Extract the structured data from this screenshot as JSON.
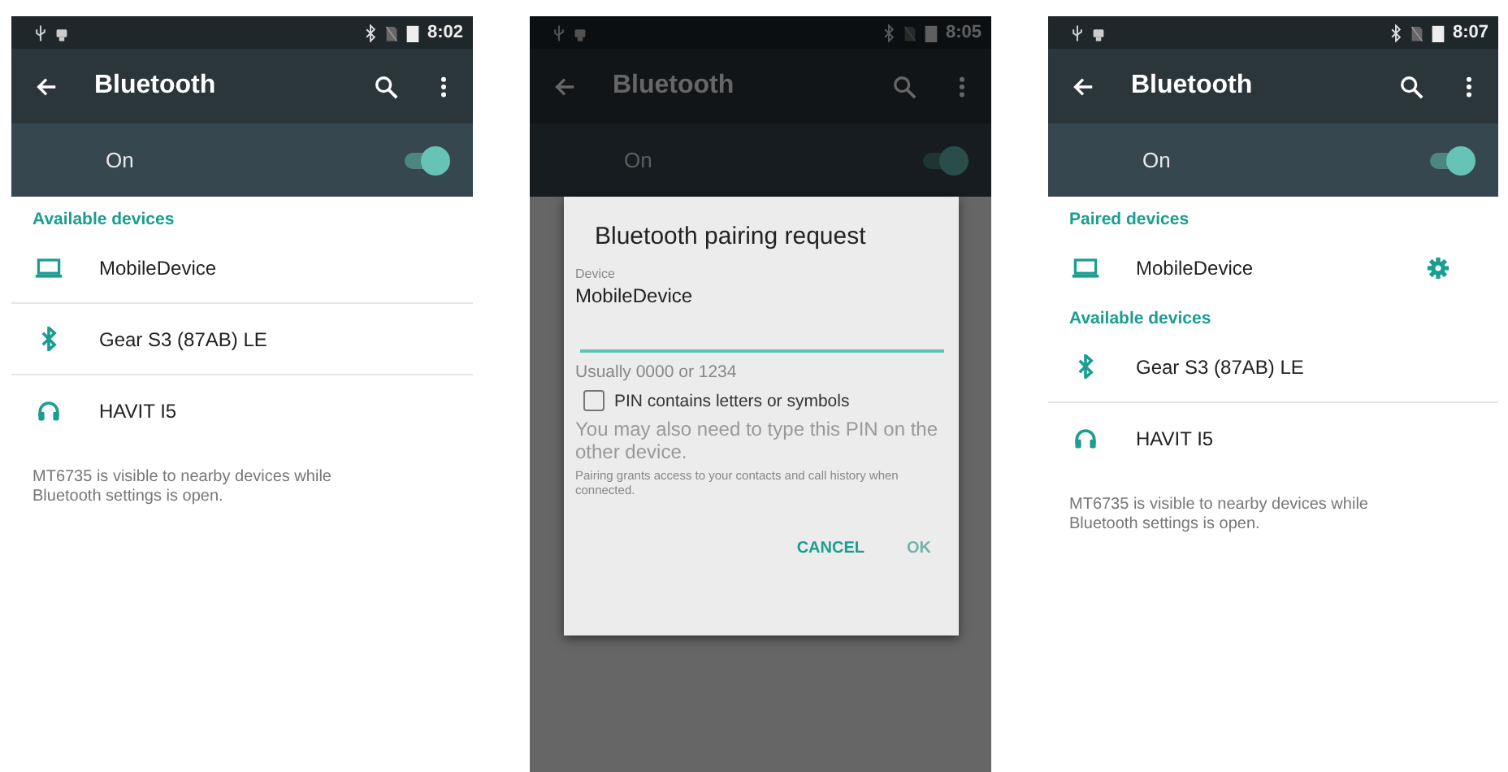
{
  "screens": [
    {
      "status_bar": {
        "time": "8:02"
      },
      "app_bar": {
        "title": "Bluetooth"
      },
      "toggle": {
        "label": "On",
        "on": true
      },
      "dimmed": false,
      "sections": [
        {
          "header": "Available devices",
          "devices": [
            {
              "name": "MobileDevice",
              "kind": "laptop",
              "settings": false
            },
            {
              "name": "Gear S3 (87AB) LE",
              "kind": "bluetooth",
              "settings": false
            },
            {
              "name": "HAVIT I5",
              "kind": "headphones",
              "settings": false
            }
          ]
        }
      ],
      "footer_note": "MT6735 is visible to nearby devices while Bluetooth settings is open."
    },
    {
      "status_bar": {
        "time": "8:05"
      },
      "app_bar": {
        "title": "Bluetooth"
      },
      "toggle": {
        "label": "On",
        "on": true
      },
      "dimmed": true,
      "dialog": {
        "title": "Bluetooth pairing request",
        "field_label": "Device",
        "device": "MobileDevice",
        "pin_hint": "Usually 0000 or 1234",
        "checkbox": {
          "label": "PIN contains letters or symbols",
          "checked": false
        },
        "note": "You may also need to type this PIN on the other device.",
        "fine_print": "Pairing grants access to your contacts and call history when connected.",
        "buttons": [
          {
            "label": "CANCEL",
            "disabled": false
          },
          {
            "label": "OK",
            "disabled": true
          }
        ]
      }
    },
    {
      "status_bar": {
        "time": "8:07"
      },
      "app_bar": {
        "title": "Bluetooth"
      },
      "toggle": {
        "label": "On",
        "on": true
      },
      "dimmed": false,
      "sections": [
        {
          "header": "Paired devices",
          "devices": [
            {
              "name": "MobileDevice",
              "kind": "laptop",
              "settings": true
            }
          ]
        },
        {
          "header": "Available devices",
          "devices": [
            {
              "name": "Gear S3 (87AB) LE",
              "kind": "bluetooth",
              "settings": false
            },
            {
              "name": "HAVIT I5",
              "kind": "headphones",
              "settings": false
            }
          ]
        }
      ],
      "footer_note": "MT6735 is visible to nearby devices while Bluetooth settings is open."
    }
  ]
}
